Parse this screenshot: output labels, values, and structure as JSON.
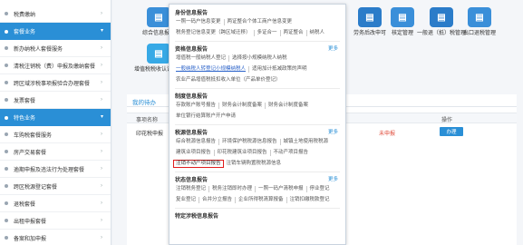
{
  "sidebar": {
    "items": [
      {
        "label": "税费缴纳",
        "type": "item"
      },
      {
        "label": "套餐业务",
        "type": "category"
      },
      {
        "label": "新办纳税人套餐服务",
        "type": "item"
      },
      {
        "label": "清税注销税（费）申报及缴纳套餐",
        "type": "item"
      },
      {
        "label": "跨区域涉税事项报验合办理套餐",
        "type": "item"
      },
      {
        "label": "发票套餐",
        "type": "item"
      },
      {
        "label": "特色业务",
        "type": "category"
      },
      {
        "label": "车购税套餐服务",
        "type": "item"
      },
      {
        "label": "房产交易套餐",
        "type": "item"
      },
      {
        "label": "逾期申报及违法行为处理套餐",
        "type": "item"
      },
      {
        "label": "跨区税源登记套餐",
        "type": "item"
      },
      {
        "label": "退税套餐",
        "type": "item"
      },
      {
        "label": "出租申报套餐",
        "type": "item"
      },
      {
        "label": "备案和加申报",
        "type": "item"
      }
    ]
  },
  "tiles": [
    {
      "label": "综合信息报告",
      "icon": "doc-icon",
      "color": "#3a8fd9"
    },
    {
      "label": "增值税税收认证管理",
      "icon": "cert-icon",
      "color": "#37a9e6"
    },
    {
      "label": "劳务后改申可",
      "icon": "form-icon",
      "color": "#2b7cc9"
    },
    {
      "label": "核定管理",
      "icon": "edit-icon",
      "color": "#3a8fd9"
    },
    {
      "label": "一般退（抵）税管理",
      "icon": "refund-icon",
      "color": "#2b7cc9"
    },
    {
      "label": "出口退税管理",
      "icon": "export-icon",
      "color": "#3a8fd9"
    }
  ],
  "panel": {
    "tab": "我的待办",
    "columns": [
      "事项名称",
      "操作"
    ],
    "rows": [
      {
        "name": "印花税申报",
        "status": "未申报",
        "action": "办理"
      }
    ]
  },
  "menu": {
    "sections": [
      {
        "title": "身份信息报告",
        "more": "",
        "rows": [
          [
            {
              "t": "一照一码户信息变更"
            },
            {
              "t": "两证整合个体工商户信息变更"
            }
          ],
          [
            {
              "t": "税务登记信息变更（跨区域迁移）"
            },
            {
              "t": "多证合一"
            },
            {
              "t": "两证整合"
            },
            {
              "t": "纳税人"
            }
          ]
        ]
      },
      {
        "title": "资格信息报告",
        "more": "更多",
        "rows": [
          [
            {
              "t": "增值税一般纳税人登记"
            },
            {
              "t": "选择按小规模纳税人纳税"
            }
          ],
          [
            {
              "t": "一般纳税人转登记小规模纳税人",
              "style": "blue"
            },
            {
              "t": "适用加计抵减政策的声明"
            }
          ],
          [
            {
              "t": "农业产品增值税抵扣收入单位（产品单价登记）"
            }
          ]
        ]
      },
      {
        "title": "制度信息报告",
        "more": "",
        "rows": [
          [
            {
              "t": "存款账户账号报告"
            },
            {
              "t": "财务会计制度备案"
            },
            {
              "t": "财务会计制度备案"
            }
          ],
          [
            {
              "t": "单位银行结算账户开户申请"
            }
          ]
        ]
      },
      {
        "title": "税源信息报告",
        "more": "更多",
        "rows": [
          [
            {
              "t": "综合税源信息报告"
            },
            {
              "t": "环境保护税税源信息报告"
            },
            {
              "t": "城镇土地使用税税源"
            }
          ],
          [
            {
              "t": "建筑业项目报告"
            },
            {
              "t": "印花税建筑业项目报告"
            },
            {
              "t": "不动产项目报告"
            }
          ],
          [
            {
              "t": "注销不动产项目报告",
              "style": "hl"
            },
            {
              "t": "注销车辆购置税税源信息"
            }
          ]
        ]
      },
      {
        "title": "状态信息报告",
        "more": "更多",
        "rows": [
          [
            {
              "t": "注销税务登记"
            },
            {
              "t": "税务注销即时办理"
            },
            {
              "t": "一照一码户清税申报"
            },
            {
              "t": "停业登记"
            }
          ],
          [
            {
              "t": "复业登记"
            },
            {
              "t": "合并分立报告"
            },
            {
              "t": "企业所得税清算报备"
            },
            {
              "t": "注销扣缴税款登记"
            }
          ]
        ]
      },
      {
        "title": "特定涉税信息报告",
        "more": "",
        "rows": []
      }
    ]
  }
}
